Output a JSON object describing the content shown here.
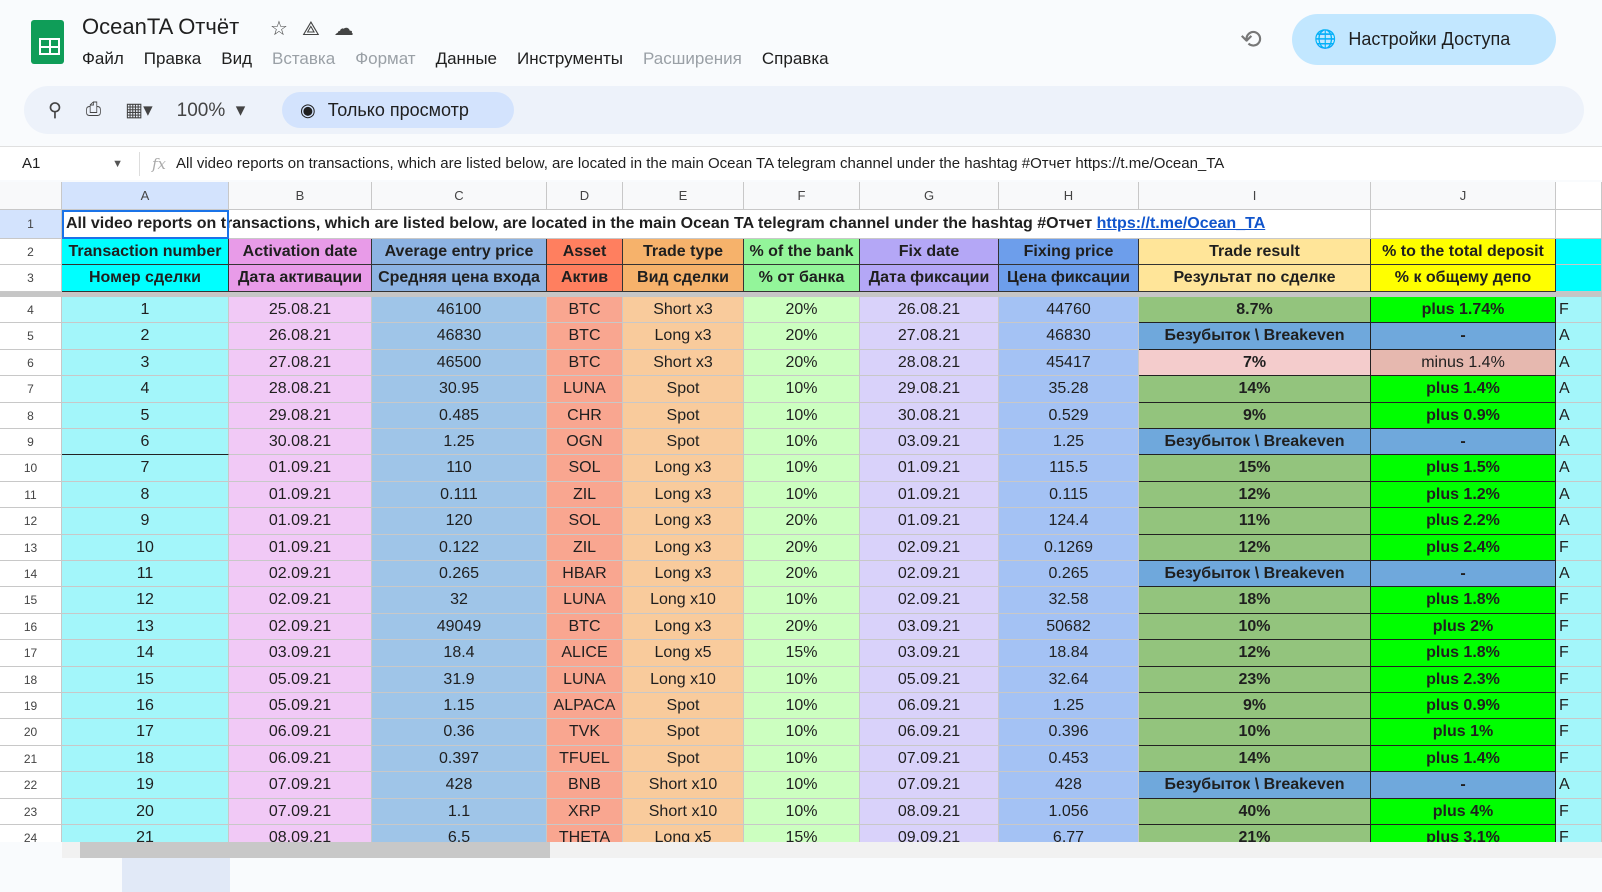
{
  "app": {
    "title": "OceanTA Отчёт",
    "share_label": "Настройки Доступа",
    "menu": [
      {
        "label": "Файл",
        "enabled": true
      },
      {
        "label": "Правка",
        "enabled": true
      },
      {
        "label": "Вид",
        "enabled": true
      },
      {
        "label": "Вставка",
        "enabled": false
      },
      {
        "label": "Формат",
        "enabled": false
      },
      {
        "label": "Данные",
        "enabled": true
      },
      {
        "label": "Инструменты",
        "enabled": true
      },
      {
        "label": "Расширения",
        "enabled": false
      },
      {
        "label": "Справка",
        "enabled": true
      }
    ]
  },
  "toolbar": {
    "zoom": "100%",
    "view_only": "Только просмотр"
  },
  "formula_bar": {
    "cell_ref": "A1",
    "content": "All video reports on transactions, which are listed below, are located in the main Ocean TA telegram channel under the hashtag #Отчет https://t.me/Ocean_TA"
  },
  "columns": [
    "A",
    "B",
    "C",
    "D",
    "E",
    "F",
    "G",
    "H",
    "I",
    "J"
  ],
  "row1": {
    "text": "All video reports on transactions, which are listed below, are located in the main Ocean TA telegram channel under the hashtag #Отчет ",
    "link": "https://t.me/Ocean_TA"
  },
  "headers_en": [
    "Transaction number",
    "Activation date",
    "Average entry price",
    "Asset",
    "Trade type",
    "% of the bank",
    "Fix date",
    "Fixing price",
    "Trade result",
    "% to the total deposit"
  ],
  "headers_ru": [
    "Номер сделки",
    "Дата активации",
    "Средняя цена входа",
    "Актив",
    "Вид сделки",
    "% от банка",
    "Дата фиксации",
    "Цена фиксации",
    "Результат по сделке",
    "% к общему депо"
  ],
  "colors": {
    "header": [
      "#00ffff",
      "#e89be8",
      "#8db3e2",
      "#ff7f5f",
      "#f6b26b",
      "#93f59a",
      "#b4a7f6",
      "#6d9eeb",
      "#ffe599",
      "#ffff00"
    ],
    "data": [
      "#a3f6fa",
      "#f1c9f6",
      "#9fc5e8",
      "#f9a690",
      "#f9cb9c",
      "#ccffc0",
      "#d9d2fa",
      "#a4c2f4"
    ],
    "profit": "#93c47d",
    "profit_pct": "#00ff00",
    "breakeven": "#6fa8dc",
    "loss": "#f4cccc",
    "loss_pct": "#e6b8af"
  },
  "rows": [
    [
      "1",
      "25.08.21",
      "46100",
      "BTC",
      "Short x3",
      "20%",
      "26.08.21",
      "44760",
      "8.7%",
      "plus 1.74%",
      "profit",
      "F"
    ],
    [
      "2",
      "26.08.21",
      "46830",
      "BTC",
      "Long x3",
      "20%",
      "27.08.21",
      "46830",
      "Безубыток \\ Breakeven",
      "-",
      "breakeven",
      "A"
    ],
    [
      "3",
      "27.08.21",
      "46500",
      "BTC",
      "Short x3",
      "20%",
      "28.08.21",
      "45417",
      "7%",
      "minus 1.4%",
      "loss",
      "A"
    ],
    [
      "4",
      "28.08.21",
      "30.95",
      "LUNA",
      "Spot",
      "10%",
      "29.08.21",
      "35.28",
      "14%",
      "plus 1.4%",
      "profit",
      "A"
    ],
    [
      "5",
      "29.08.21",
      "0.485",
      "CHR",
      "Spot",
      "10%",
      "30.08.21",
      "0.529",
      "9%",
      "plus 0.9%",
      "profit",
      "A"
    ],
    [
      "6",
      "30.08.21",
      "1.25",
      "OGN",
      "Spot",
      "10%",
      "03.09.21",
      "1.25",
      "Безубыток \\ Breakeven",
      "-",
      "breakeven",
      "A"
    ],
    [
      "7",
      "01.09.21",
      "110",
      "SOL",
      "Long x3",
      "10%",
      "01.09.21",
      "115.5",
      "15%",
      "plus 1.5%",
      "profit",
      "A"
    ],
    [
      "8",
      "01.09.21",
      "0.111",
      "ZIL",
      "Long x3",
      "10%",
      "01.09.21",
      "0.115",
      "12%",
      "plus 1.2%",
      "profit",
      "A"
    ],
    [
      "9",
      "01.09.21",
      "120",
      "SOL",
      "Long x3",
      "20%",
      "01.09.21",
      "124.4",
      "11%",
      "plus 2.2%",
      "profit",
      "A"
    ],
    [
      "10",
      "01.09.21",
      "0.122",
      "ZIL",
      "Long x3",
      "20%",
      "02.09.21",
      "0.1269",
      "12%",
      "plus 2.4%",
      "profit",
      "F"
    ],
    [
      "11",
      "02.09.21",
      "0.265",
      "HBAR",
      "Long x3",
      "20%",
      "02.09.21",
      "0.265",
      "Безубыток \\ Breakeven",
      "-",
      "breakeven",
      "A"
    ],
    [
      "12",
      "02.09.21",
      "32",
      "LUNA",
      "Long x10",
      "10%",
      "02.09.21",
      "32.58",
      "18%",
      "plus 1.8%",
      "profit",
      "F"
    ],
    [
      "13",
      "02.09.21",
      "49049",
      "BTC",
      "Long x3",
      "20%",
      "03.09.21",
      "50682",
      "10%",
      "plus 2%",
      "profit",
      "F"
    ],
    [
      "14",
      "03.09.21",
      "18.4",
      "ALICE",
      "Long x5",
      "15%",
      "03.09.21",
      "18.84",
      "12%",
      "plus 1.8%",
      "profit",
      "F"
    ],
    [
      "15",
      "05.09.21",
      "31.9",
      "LUNA",
      "Long x10",
      "10%",
      "05.09.21",
      "32.64",
      "23%",
      "plus 2.3%",
      "profit",
      "F"
    ],
    [
      "16",
      "05.09.21",
      "1.15",
      "ALPACA",
      "Spot",
      "10%",
      "06.09.21",
      "1.25",
      "9%",
      "plus 0.9%",
      "profit",
      "F"
    ],
    [
      "17",
      "06.09.21",
      "0.36",
      "TVK",
      "Spot",
      "10%",
      "06.09.21",
      "0.396",
      "10%",
      "plus 1%",
      "profit",
      "F"
    ],
    [
      "18",
      "06.09.21",
      "0.397",
      "TFUEL",
      "Spot",
      "10%",
      "07.09.21",
      "0.453",
      "14%",
      "plus 1.4%",
      "profit",
      "F"
    ],
    [
      "19",
      "07.09.21",
      "428",
      "BNB",
      "Short x10",
      "10%",
      "07.09.21",
      "428",
      "Безубыток \\ Breakeven",
      "-",
      "breakeven",
      "A"
    ],
    [
      "20",
      "07.09.21",
      "1.1",
      "XRP",
      "Short x10",
      "10%",
      "08.09.21",
      "1.056",
      "40%",
      "plus 4%",
      "profit",
      "F"
    ],
    [
      "21",
      "08.09.21",
      "6.5",
      "THETA",
      "Long x5",
      "15%",
      "09.09.21",
      "6.77",
      "21%",
      "plus 3.1%",
      "profit",
      "F"
    ]
  ]
}
